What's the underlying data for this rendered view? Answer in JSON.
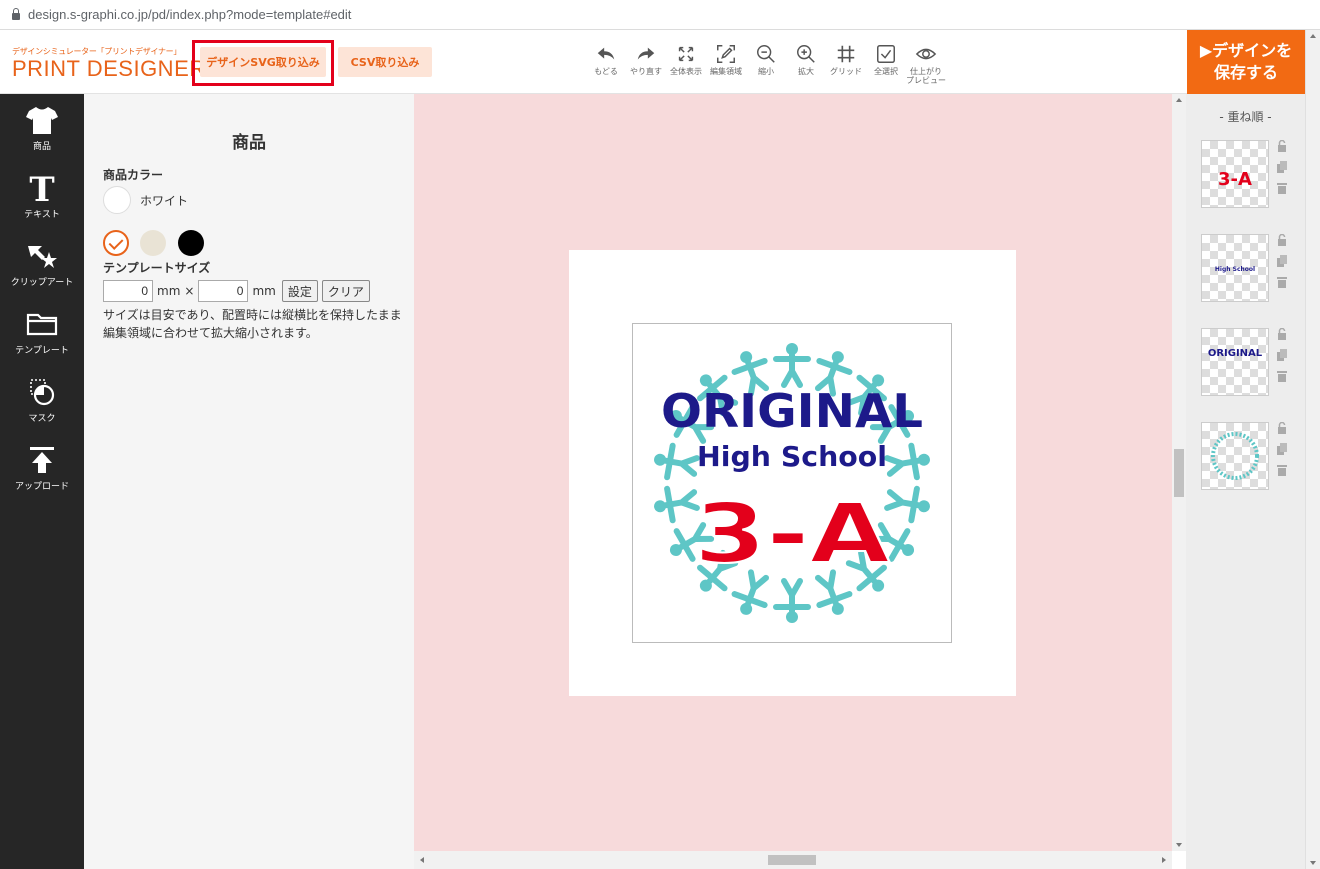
{
  "browser": {
    "url": "design.s-graphi.co.jp/pd/index.php?mode=template#edit"
  },
  "brand": {
    "subtitle": "デザインシミュレーター「プリントデザイナー」",
    "name": "PRINT DESIGNER"
  },
  "header": {
    "svg_import": "デザインSVG取り込み",
    "csv_import": "CSV取り込み",
    "save_line1": "▶デザインを",
    "save_line2": "保存する"
  },
  "toolbar": [
    {
      "label": "もどる",
      "icon": "undo-icon"
    },
    {
      "label": "やり直す",
      "icon": "redo-icon"
    },
    {
      "label": "全体表示",
      "icon": "fit-screen-icon"
    },
    {
      "label": "編集領域",
      "icon": "edit-area-icon"
    },
    {
      "label": "縮小",
      "icon": "zoom-out-icon"
    },
    {
      "label": "拡大",
      "icon": "zoom-in-icon"
    },
    {
      "label": "グリッド",
      "icon": "grid-icon"
    },
    {
      "label": "全選択",
      "icon": "select-all-icon"
    },
    {
      "label": "仕上がり\nプレビュー",
      "icon": "eye-icon"
    }
  ],
  "sidebar": [
    {
      "label": "商品",
      "icon": "tshirt-icon"
    },
    {
      "label": "テキスト",
      "icon": "text-icon"
    },
    {
      "label": "クリップアート",
      "icon": "clipart-icon"
    },
    {
      "label": "テンプレート",
      "icon": "folder-icon"
    },
    {
      "label": "マスク",
      "icon": "mask-icon"
    },
    {
      "label": "アップロード",
      "icon": "upload-icon"
    }
  ],
  "panel": {
    "title": "商品",
    "color_label": "商品カラー",
    "color_name": "ホワイト",
    "size_label": "テンプレートサイズ",
    "width_value": "0",
    "height_value": "0",
    "unit": "mm",
    "times": "×",
    "set_button": "設定",
    "clear_button": "クリア",
    "note": "サイズは目安であり、配置時には縦横比を保持したまま編集領域に合わせて拡大縮小されます。"
  },
  "design": {
    "line1": "ORIGINAL",
    "line2": "High School",
    "line3": "3-A"
  },
  "layers": {
    "title": "- 重ね順 -"
  },
  "colors": {
    "accent": "#f26a13",
    "highlight": "#e3001b",
    "canvas_bg": "#f7dadb",
    "navy": "#1d1a8a",
    "red": "#e3001b",
    "teal": "#5ec6c6"
  }
}
